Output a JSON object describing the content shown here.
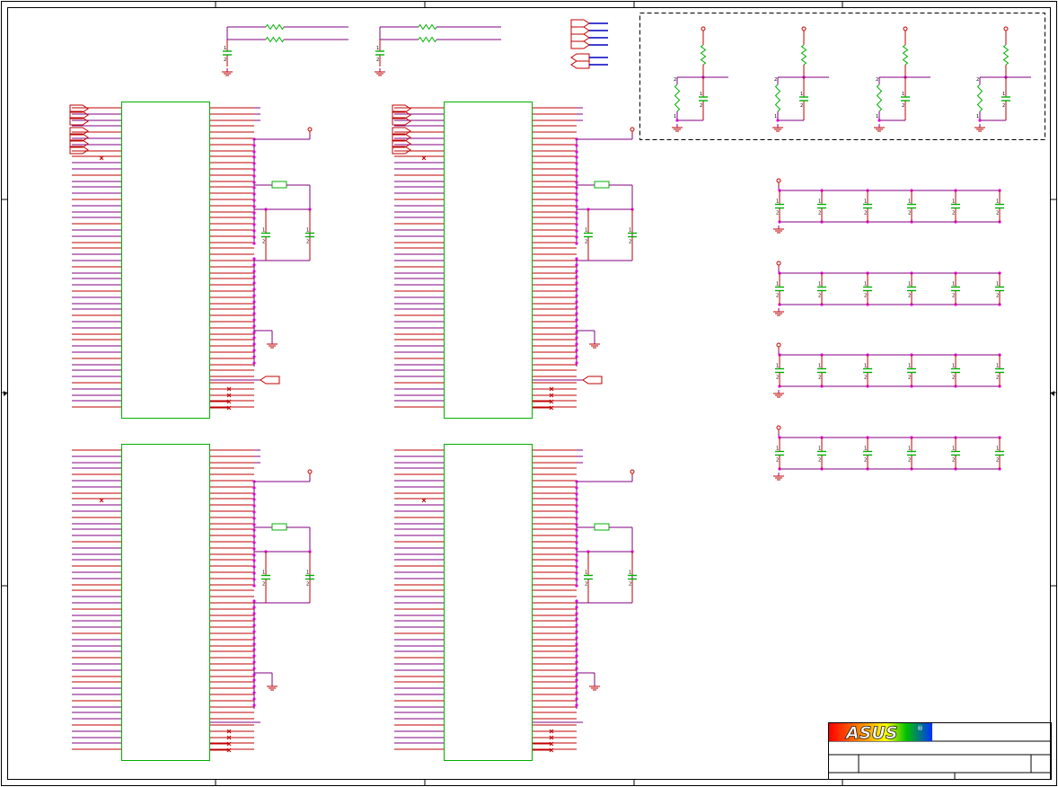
{
  "diagram": {
    "kind": "schematic",
    "logo_text": "ASUS",
    "logo_registered": "®",
    "colors": {
      "wire": "#800080",
      "pin": "#c00000",
      "component": "#00b000",
      "junction": "#e000e0",
      "net_blue": "#0000c0",
      "ground": "#c00000",
      "border": "#000000",
      "logo_red": "#ff0000",
      "logo_orange": "#ff9900",
      "logo_yellow": "#ffff00",
      "logo_green": "#00c000",
      "logo_blue": "#0030ff"
    },
    "ic_blocks": [
      {
        "name": "ic-block-top-left"
      },
      {
        "name": "ic-block-top-right"
      },
      {
        "name": "ic-block-bottom-left"
      },
      {
        "name": "ic-block-bottom-right"
      }
    ],
    "decoupling_rows": 4,
    "caps_per_row": 6,
    "pullup_dividers": 4,
    "pin_label_one": "1",
    "pin_label_two": "2"
  }
}
